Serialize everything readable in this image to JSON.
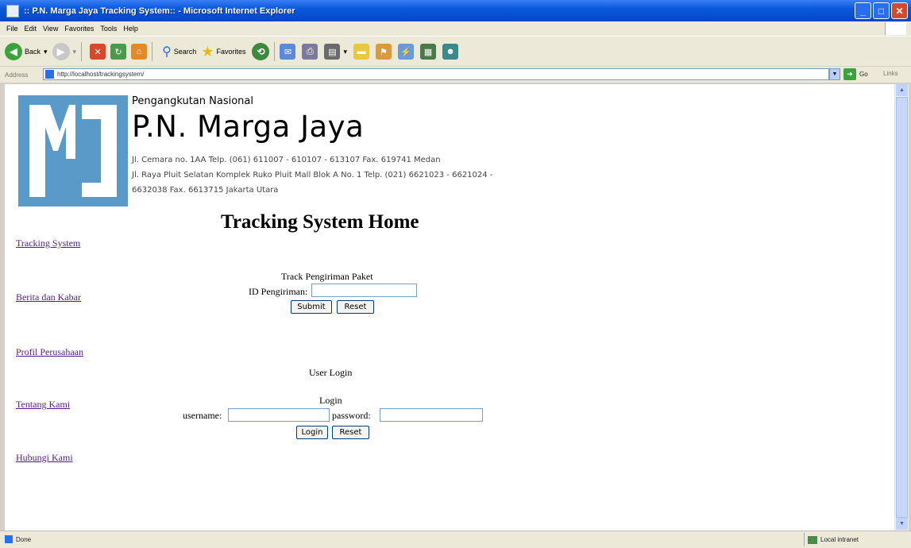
{
  "window": {
    "title": ":: P.N. Marga Jaya Tracking System:: - Microsoft Internet Explorer"
  },
  "menu": [
    "File",
    "Edit",
    "View",
    "Favorites",
    "Tools",
    "Help"
  ],
  "toolbar": {
    "back": "Back",
    "search": "Search",
    "favorites": "Favorites"
  },
  "address": {
    "label": "Address",
    "url": "http://localhost/trackingsystem/",
    "go": "Go",
    "links": "Links"
  },
  "page": {
    "company_subtitle": "Pengangkutan Nasional",
    "company_name": "P.N. Marga Jaya",
    "address_line1": "Jl. Cemara no. 1AA Telp. (061) 611007 - 610107 - 613107 Fax. 619741 Medan",
    "address_line2": "Jl. Raya Pluit Selatan Komplek Ruko Pluit Mall Blok A No. 1 Telp. (021) 6621023 - 6621024 -",
    "address_line3": "6632038 Fax. 6613715 Jakarta Utara",
    "title": "Tracking System Home",
    "nav": [
      "Tracking System",
      "Berita dan Kabar",
      "Profil Perusahaan",
      "Tentang Kami",
      "Hubungi Kami"
    ],
    "track": {
      "heading": "Track Pengiriman Paket",
      "id_label": "ID Pengiriman:",
      "id_value": "",
      "submit": "Submit",
      "reset": "Reset"
    },
    "login": {
      "section_heading": "User Login",
      "heading": "Login",
      "username_label": "username:",
      "username_value": "",
      "password_label": "password:",
      "password_value": "",
      "login_button": "Login",
      "reset": "Reset"
    }
  },
  "status": {
    "text": "Done",
    "zone": "Local intranet"
  },
  "colors": {
    "titlebar": "#0a58dc",
    "logo": "#5a9ac8",
    "link_visited": "#551a8b"
  }
}
